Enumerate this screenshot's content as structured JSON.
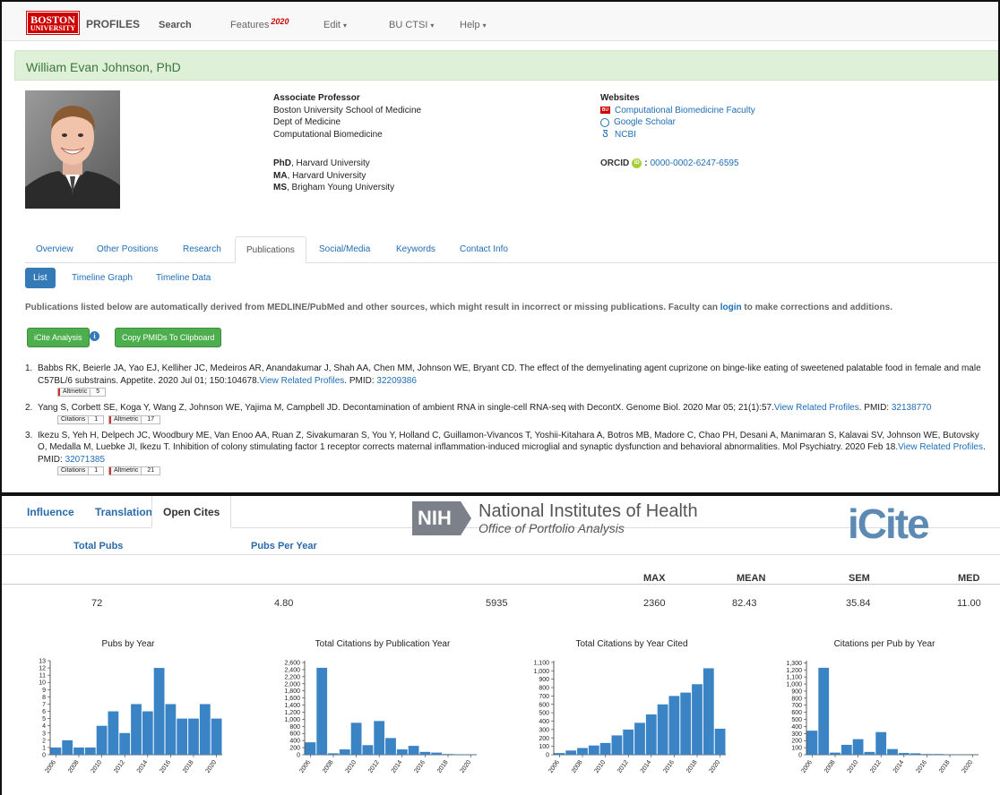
{
  "nav": {
    "brand_logo_line1": "BOSTON",
    "brand_logo_line2": "UNIVERSITY",
    "brand": "PROFILES",
    "search": "Search",
    "features": "Features",
    "features_year": "2020",
    "edit": "Edit",
    "bu_ctsi": "BU CTSI",
    "help": "Help"
  },
  "profile": {
    "name": "William Evan Johnson, PhD",
    "title": "Associate Professor",
    "appointments": [
      "Boston University School of Medicine",
      "Dept of Medicine",
      "Computational Biomedicine"
    ],
    "degrees": [
      {
        "deg": "PhD",
        "school": ", Harvard University"
      },
      {
        "deg": "MA",
        "school": ", Harvard University"
      },
      {
        "deg": "MS",
        "school": ", Brigham Young University"
      }
    ],
    "websites_label": "Websites",
    "websites": [
      "Computational Biomedicine Faculty",
      "Google Scholar",
      "NCBI"
    ],
    "orcid_label": "ORCID",
    "orcid_sep": ":",
    "orcid_id": "0000-0002-6247-6595"
  },
  "tabs": [
    "Overview",
    "Other Positions",
    "Research",
    "Publications",
    "Social/Media",
    "Keywords",
    "Contact Info"
  ],
  "pills": [
    "List",
    "Timeline Graph",
    "Timeline Data"
  ],
  "disclaimer": {
    "pre": "Publications listed below are automatically derived from MEDLINE/PubMed and other sources, which might result in incorrect or missing publications. Faculty can ",
    "link": "login",
    "post": " to make corrections and additions."
  },
  "buttons": {
    "icite": "iCite Analysis",
    "copy": "Copy PMIDs To Clipboard",
    "info_glyph": "i"
  },
  "publications": [
    {
      "num": "1.",
      "text": "Babbs RK, Beierle JA, Yao EJ, Kelliher JC, Medeiros AR, Anandakumar J, Shah AA, Chen MM, Johnson WE, Bryant CD. The effect of the demyelinating agent cuprizone on binge-like eating of sweetened palatable food in female and male C57BL/6 substrains. Appetite. 2020 Jul 01; 150:104678.",
      "related": "View Related Profiles",
      "pmid_label": ". PMID: ",
      "pmid": "32209386",
      "citations": null,
      "altmetric": "5"
    },
    {
      "num": "2.",
      "text": "Yang S, Corbett SE, Koga Y, Wang Z, Johnson WE, Yajima M, Campbell JD. Decontamination of ambient RNA in single-cell RNA-seq with DecontX. Genome Biol. 2020 Mar 05; 21(1):57.",
      "related": "View Related Profiles",
      "pmid_label": ". PMID: ",
      "pmid": "32138770",
      "citations": "1",
      "altmetric": "17"
    },
    {
      "num": "3.",
      "text": "Ikezu S, Yeh H, Delpech JC, Woodbury ME, Van Enoo AA, Ruan Z, Sivakumaran S, You Y, Holland C, Guillamon-Vivancos T, Yoshii-Kitahara A, Botros MB, Madore C, Chao PH, Desani A, Manimaran S, Kalavai SV, Johnson WE, Butovsky O, Medalla M, Luebke JI, Ikezu T. Inhibition of colony stimulating factor 1 receptor corrects maternal inflammation-induced microglial and synaptic dysfunction and behavioral abnormalities. Mol Psychiatry. 2020 Feb 18.",
      "related": "View Related Profiles",
      "pmid_label": ". PMID: ",
      "pmid": "32071385",
      "citations": "1",
      "altmetric": "21"
    }
  ],
  "badge_labels": {
    "citations": "Citations",
    "altmetric": "Altmetric"
  },
  "icite": {
    "tabs": [
      "Influence",
      "Translation",
      "Open Cites"
    ],
    "nih_abbr": "NIH",
    "nih_name": "National Institutes of Health",
    "nih_office": "Office of Portfolio Analysis",
    "icite_logo": "iCite",
    "col_headers": [
      "Total Pubs",
      "Pubs Per Year"
    ],
    "stat_headers": [
      "MAX",
      "MEAN",
      "SEM",
      "MED"
    ],
    "values": [
      "72",
      "4.80",
      "5935",
      "2360",
      "82.43",
      "35.84",
      "11.00"
    ]
  },
  "chart_data": [
    {
      "type": "bar",
      "title": "Pubs by Year",
      "x": [
        2006,
        2007,
        2008,
        2009,
        2010,
        2011,
        2012,
        2013,
        2014,
        2015,
        2016,
        2017,
        2018,
        2019,
        2020
      ],
      "values": [
        1,
        2,
        1,
        1,
        4,
        6,
        3,
        7,
        6,
        12,
        7,
        5,
        5,
        7,
        5
      ],
      "yticks": [
        0,
        1,
        2,
        3,
        4,
        5,
        6,
        7,
        8,
        9,
        10,
        11,
        12,
        13
      ],
      "ylim": [
        0,
        13
      ],
      "xticks": [
        "2006",
        "2008",
        "2010",
        "2012",
        "2014",
        "2016",
        "2018",
        "2020"
      ]
    },
    {
      "type": "bar",
      "title": "Total Citations by Publication Year",
      "x": [
        2006,
        2007,
        2008,
        2009,
        2010,
        2011,
        2012,
        2013,
        2014,
        2015,
        2016,
        2017,
        2018,
        2019,
        2020
      ],
      "values": [
        350,
        2450,
        40,
        150,
        900,
        270,
        950,
        470,
        150,
        250,
        80,
        60,
        20,
        10,
        5
      ],
      "yticks": [
        0,
        200,
        400,
        600,
        800,
        1000,
        1200,
        1400,
        1600,
        1800,
        2000,
        2200,
        2400,
        2600
      ],
      "ytick_labels": [
        "0",
        "200",
        "400",
        "600",
        "800",
        "1,000",
        "1,200",
        "1,400",
        "1,600",
        "1,800",
        "2,000",
        "2,200",
        "2,400",
        "2,600"
      ],
      "ylim": [
        0,
        2650
      ],
      "xticks": [
        "2006",
        "2008",
        "2010",
        "2012",
        "2014",
        "2016",
        "2018",
        "2020"
      ]
    },
    {
      "type": "bar",
      "title": "Total Citations by Year Cited",
      "x": [
        2006,
        2007,
        2008,
        2009,
        2010,
        2011,
        2012,
        2013,
        2014,
        2015,
        2016,
        2017,
        2018,
        2019,
        2020
      ],
      "values": [
        20,
        50,
        80,
        110,
        140,
        230,
        300,
        380,
        480,
        600,
        700,
        740,
        840,
        1030,
        310
      ],
      "yticks": [
        0,
        100,
        200,
        300,
        400,
        500,
        600,
        700,
        800,
        900,
        1000,
        1100
      ],
      "ytick_labels": [
        "0",
        "100",
        "200",
        "300",
        "400",
        "500",
        "600",
        "700",
        "800",
        "900",
        "1,000",
        "1,100"
      ],
      "ylim": [
        0,
        1120
      ],
      "xticks": [
        "2006",
        "2008",
        "2010",
        "2012",
        "2014",
        "2016",
        "2018",
        "2020"
      ]
    },
    {
      "type": "bar",
      "title": "Citations per Pub by Year",
      "x": [
        2006,
        2007,
        2008,
        2009,
        2010,
        2011,
        2012,
        2013,
        2014,
        2015,
        2016,
        2017,
        2018,
        2019,
        2020
      ],
      "values": [
        340,
        1230,
        30,
        140,
        220,
        40,
        320,
        80,
        25,
        20,
        10,
        10,
        5,
        3,
        1
      ],
      "yticks": [
        0,
        100,
        200,
        300,
        400,
        500,
        600,
        700,
        800,
        900,
        1000,
        1100,
        1200,
        1300
      ],
      "ytick_labels": [
        "0",
        "100",
        "200",
        "300",
        "400",
        "500",
        "600",
        "700",
        "800",
        "900",
        "1,000",
        "1,100",
        "1,200",
        "1,300"
      ],
      "ylim": [
        0,
        1330
      ],
      "xticks": [
        "2006",
        "2008",
        "2010",
        "2012",
        "2014",
        "2016",
        "2018",
        "2020"
      ]
    }
  ],
  "colors": {
    "accent": "#1f6db5",
    "bar": "#3a84c6",
    "green": "#4cae4c",
    "namebar": "#dff0d8",
    "brand_red": "#cc0000"
  }
}
